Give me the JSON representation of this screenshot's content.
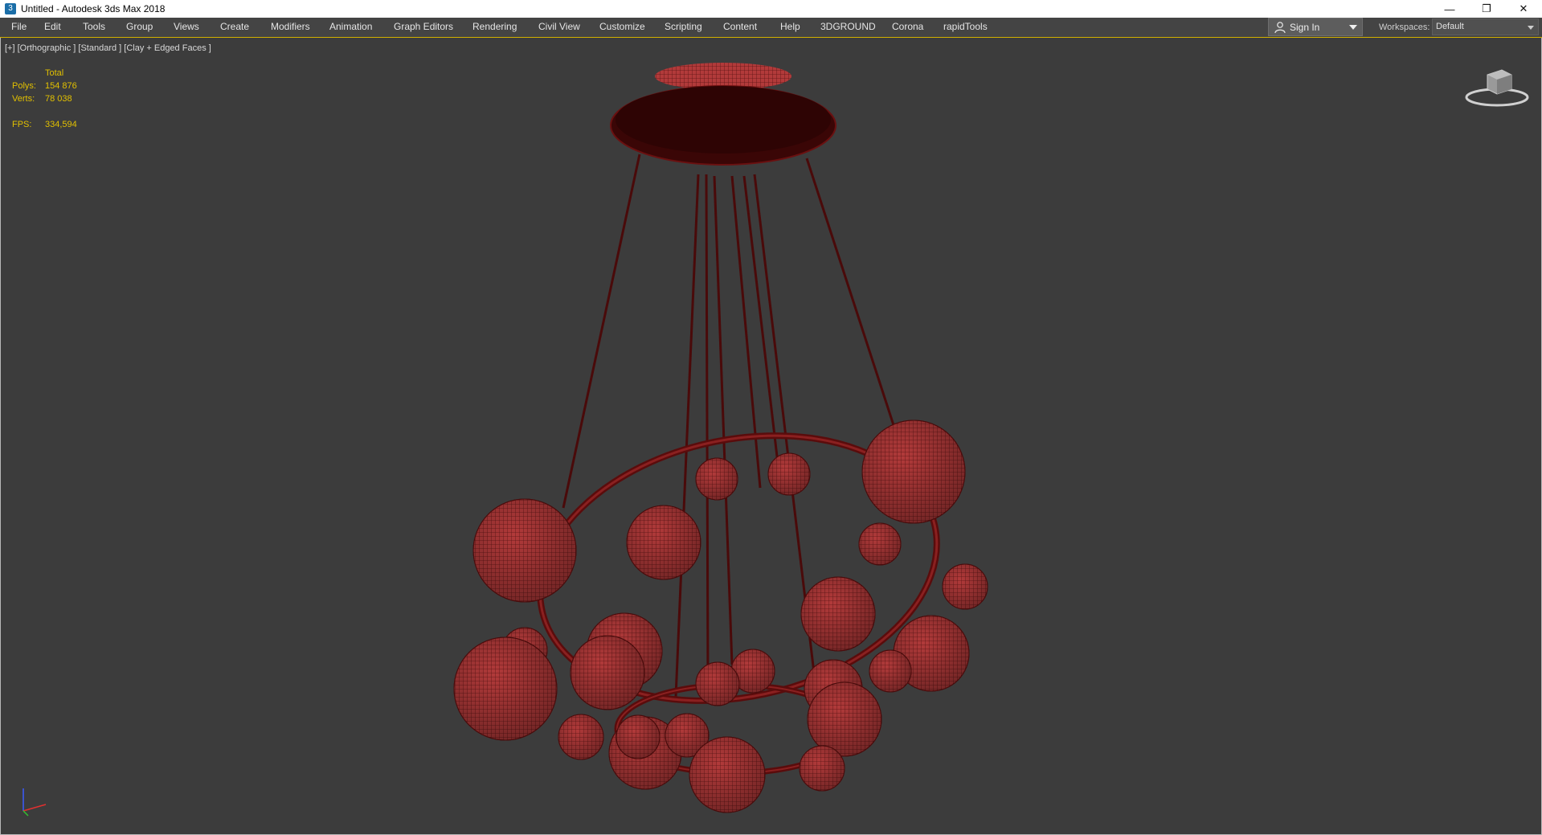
{
  "window": {
    "title": "Untitled - Autodesk 3ds Max 2018",
    "icon": "3dsmax-app-icon",
    "controls": [
      "minimize-icon",
      "restore-icon",
      "close-icon"
    ]
  },
  "menu": {
    "items": [
      "File",
      "Edit",
      "Tools",
      "Group",
      "Views",
      "Create",
      "Modifiers",
      "Animation",
      "Graph Editors",
      "Rendering",
      "Civil View",
      "Customize",
      "Scripting",
      "Content",
      "Help",
      "3DGROUND",
      "Corona",
      "rapidTools"
    ]
  },
  "account": {
    "sign_in": "Sign In"
  },
  "workspaces": {
    "label": "Workspaces:",
    "value": "Default"
  },
  "viewport": {
    "label": "[+] [Orthographic ] [Standard ] [Clay + Edged Faces ]",
    "stats": {
      "header": "Total",
      "polys_label": "Polys:",
      "polys": "154 876",
      "verts_label": "Verts:",
      "verts": "78 038",
      "fps_label": "FPS:",
      "fps": "334,594"
    }
  },
  "colors": {
    "accent": "#d1b000",
    "stats_text": "#e2c000",
    "model": "#b23a3a",
    "model_dark": "#5a0f0f",
    "viewport_bg": "#3c3c3c"
  }
}
